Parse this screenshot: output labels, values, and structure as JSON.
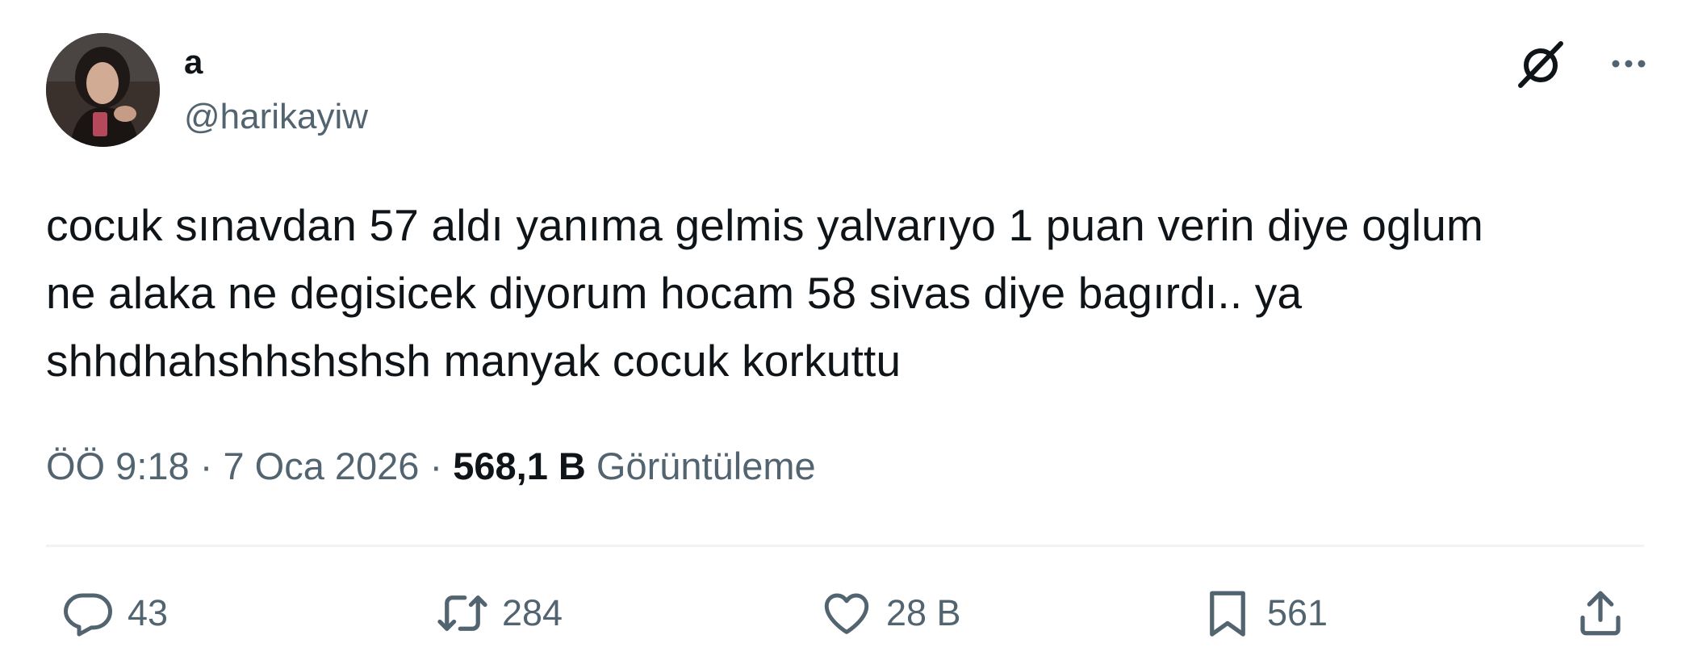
{
  "author": {
    "display_name": "a",
    "handle": "@harikayiw"
  },
  "tweet": {
    "text": "cocuk sınavdan 57 aldı yanıma gelmis yalvarıyo 1 puan verin diye oglum\nne alaka ne degisicek diyorum hocam 58 sivas diye bagırdı.. ya\nshhdhahshhshshsh manyak cocuk korkuttu"
  },
  "meta": {
    "time": "ÖÖ 9:18",
    "separator": "·",
    "date": "7 Oca 2026",
    "views_count": "568,1 B",
    "views_label": "Görüntüleme"
  },
  "actions": {
    "replies": "43",
    "retweets": "284",
    "likes": "28 B",
    "bookmarks": "561"
  },
  "icons": {
    "top_right": [
      "grok-icon",
      "more-icon"
    ],
    "action_bar": [
      "reply-icon",
      "retweet-icon",
      "like-icon",
      "bookmark-icon",
      "share-icon"
    ]
  },
  "colors": {
    "text_primary": "#0f1419",
    "text_secondary": "#536471",
    "divider": "#eff3f4"
  }
}
